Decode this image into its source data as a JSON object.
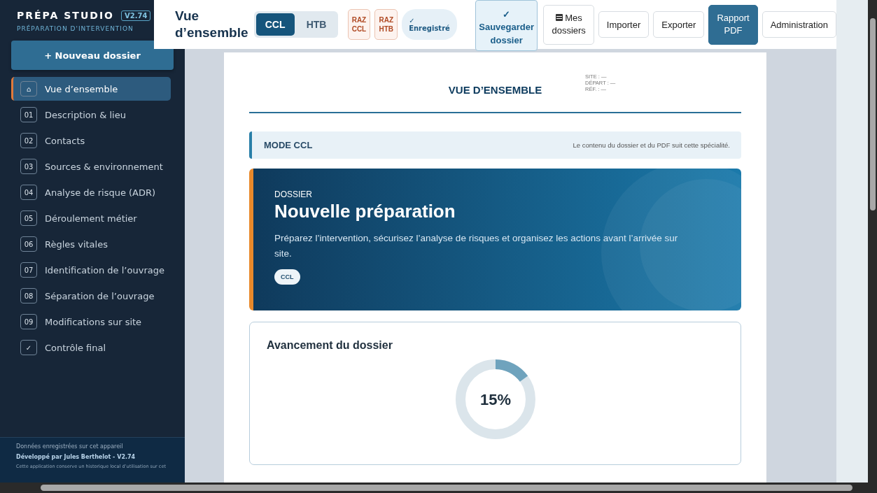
{
  "sidebar": {
    "brand": "PRÉPA STUDIO",
    "version": "V2.74",
    "subtitle": "PRÉPARATION D'INTERVENTION",
    "new_button": "+ Nouveau dossier",
    "items": [
      {
        "badge": "⌂",
        "label": "Vue d’ensemble",
        "selected": true
      },
      {
        "badge": "01",
        "label": "Description & lieu",
        "selected": false
      },
      {
        "badge": "02",
        "label": "Contacts",
        "selected": false
      },
      {
        "badge": "03",
        "label": "Sources & environnement",
        "selected": false
      },
      {
        "badge": "04",
        "label": "Analyse de risque (ADR)",
        "selected": false
      },
      {
        "badge": "05",
        "label": "Déroulement métier",
        "selected": false
      },
      {
        "badge": "06",
        "label": "Règles vitales",
        "selected": false
      },
      {
        "badge": "07",
        "label": "Identification de l’ouvrage",
        "selected": false
      },
      {
        "badge": "08",
        "label": "Séparation de l’ouvrage",
        "selected": false
      },
      {
        "badge": "09",
        "label": "Modifications sur site",
        "selected": false
      },
      {
        "badge": "✓",
        "label": "Contrôle final",
        "selected": false
      }
    ],
    "footer": {
      "note": "Données enregistrées sur cet appareil",
      "credit": "Développé par Jules Berthelot - V2.74",
      "notice": "Cette application conserve un historique local d’utilisation sur cet"
    }
  },
  "topbar": {
    "title": "Vue d’ensemble",
    "modes": [
      {
        "label": "CCL",
        "selected": true
      },
      {
        "label": "HTB",
        "selected": false
      }
    ],
    "reset_buttons": [
      "RAZ CCL",
      "RAZ HTB"
    ],
    "status": {
      "check": "✓",
      "label": "Enregistré"
    },
    "save_button": {
      "check": "✓",
      "label": "Sauvegarder dossier"
    },
    "buttons": [
      {
        "label": "Mes dossiers",
        "kind": "icon"
      },
      {
        "label": "Importer",
        "kind": "plain"
      },
      {
        "label": "Exporter",
        "kind": "plain"
      },
      {
        "label": "Rapport PDF",
        "kind": "primary"
      },
      {
        "label": "Administration",
        "kind": "plain"
      }
    ]
  },
  "page": {
    "title": "VUE D’ENSEMBLE",
    "meta": [
      "SITE : —",
      "DÉPART : —",
      "RÉF. : —"
    ],
    "mode_banner": {
      "label": "MODE CCL",
      "note": "Le contenu du dossier et du PDF suit cette spécialité."
    },
    "hero": {
      "kicker": "DOSSIER",
      "title": "Nouvelle préparation",
      "text": "Préparez l’intervention, sécurisez l’analyse de risques et organisez les actions avant l’arrivée sur site.",
      "tag": "CCL"
    },
    "progress": {
      "title": "Avancement du dossier",
      "level": 0.15,
      "reading": "15%"
    }
  }
}
